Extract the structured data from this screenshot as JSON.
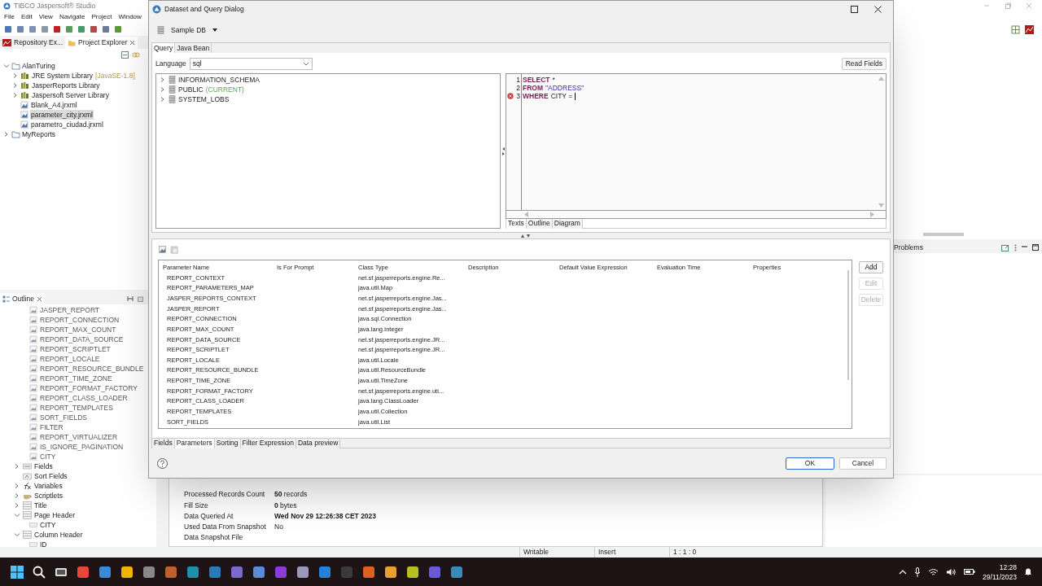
{
  "ide": {
    "title": "TIBCO Jaspersoft® Studio",
    "menu": [
      "File",
      "Edit",
      "View",
      "Navigate",
      "Project",
      "Window"
    ],
    "explorer_tabs": [
      {
        "label": "Repository Ex...",
        "selected": false
      },
      {
        "label": "Project Explorer",
        "selected": true
      }
    ],
    "explorer_tree": [
      {
        "label": "AlanTuring",
        "kind": "project",
        "expanded": true,
        "children": [
          {
            "label": "JRE System Library",
            "decoration": "[JavaSE-1.8]",
            "kind": "library",
            "expanded": false,
            "selected": false
          },
          {
            "label": "JasperReports Library",
            "kind": "library",
            "expanded": false,
            "selected": false
          },
          {
            "label": "Jaspersoft Server Library",
            "kind": "library",
            "expanded": false,
            "selected": false
          },
          {
            "label": "Blank_A4.jrxml",
            "kind": "file",
            "selected": false
          },
          {
            "label": "parameter_city.jrxml",
            "kind": "file",
            "selected": true
          },
          {
            "label": "parametro_ciudad.jrxml",
            "kind": "file",
            "selected": false
          }
        ]
      },
      {
        "label": "MyReports",
        "kind": "project",
        "expanded": false
      }
    ],
    "outline_tab": "Outline",
    "outline_parameters": [
      "JASPER_REPORT",
      "REPORT_CONNECTION",
      "REPORT_MAX_COUNT",
      "REPORT_DATA_SOURCE",
      "REPORT_SCRIPTLET",
      "REPORT_LOCALE",
      "REPORT_RESOURCE_BUNDLE",
      "REPORT_TIME_ZONE",
      "REPORT_FORMAT_FACTORY",
      "REPORT_CLASS_LOADER",
      "REPORT_TEMPLATES",
      "SORT_FIELDS",
      "FILTER",
      "REPORT_VIRTUALIZER",
      "IS_IGNORE_PAGINATION",
      "CITY"
    ],
    "outline_items": [
      {
        "label": "Fields",
        "kind": "fields",
        "expanded": false
      },
      {
        "label": "Sort Fields",
        "kind": "sort"
      },
      {
        "label": "Variables",
        "kind": "variables",
        "expanded": false
      },
      {
        "label": "Scriptlets",
        "kind": "scriptlets",
        "expanded": false
      },
      {
        "label": "Title",
        "kind": "band",
        "expanded": false
      },
      {
        "label": "Page Header",
        "kind": "band",
        "expanded": true,
        "children": [
          {
            "label": "CITY"
          }
        ]
      },
      {
        "label": "Column Header",
        "kind": "band",
        "expanded": true,
        "children": [
          {
            "label": "ID"
          }
        ]
      }
    ],
    "problems_tab": "Problems",
    "report_info": [
      {
        "label": "Processed Records Count",
        "value": "**50** records"
      },
      {
        "label": "Fill Size",
        "value": "**0** bytes"
      },
      {
        "label": "Data Queried At",
        "value": "**Wed Nov 29 12:26:38 CET 2023**"
      },
      {
        "label": "Used Data From Snapshot",
        "value": "No"
      },
      {
        "label": "Data Snapshot File"
      }
    ],
    "status_bar": [
      "Writable",
      "Insert",
      "1 : 1 : 0"
    ]
  },
  "dialog": {
    "title": "Dataset and Query Dialog",
    "data_adapter": "Sample DB",
    "top_tabs": [
      {
        "label": "Query",
        "selected": true
      },
      {
        "label": "Java Bean",
        "selected": false
      }
    ],
    "language_label": "Language",
    "language": "sql",
    "read_fields": "Read Fields",
    "schemas": [
      {
        "label": "INFORMATION_SCHEMA"
      },
      {
        "label": "PUBLIC",
        "note": "(CURRENT)"
      },
      {
        "label": "SYSTEM_LOBS"
      }
    ],
    "query_lines": [
      {
        "number": "1",
        "error": false,
        "tokens": [
          {
            "kind": "keyword",
            "text": "SELECT"
          },
          {
            "kind": "plain",
            "text": "*"
          }
        ]
      },
      {
        "number": "2",
        "error": false,
        "tokens": [
          {
            "kind": "keyword",
            "text": "FROM"
          },
          {
            "kind": "string",
            "text": "\"ADDRESS\""
          }
        ]
      },
      {
        "number": "3",
        "error": true,
        "tokens": [
          {
            "kind": "keyword",
            "text": "WHERE"
          },
          {
            "kind": "plain",
            "text": "CITY ="
          }
        ]
      }
    ],
    "editor_tabs": [
      {
        "label": "Texts",
        "selected": true
      },
      {
        "label": "Outline",
        "selected": false
      },
      {
        "label": "Diagram",
        "selected": false
      }
    ],
    "table": {
      "columns": [
        "Parameter Name",
        "Is For Prompt",
        "Class Type",
        "Description",
        "Default Value Expression",
        "Evaluation Time",
        "Properties"
      ],
      "rows": [
        {
          "name": "REPORT_CONTEXT",
          "class_type": "net.sf.jasperreports.engine.Re..."
        },
        {
          "name": "REPORT_PARAMETERS_MAP",
          "class_type": "java.util.Map"
        },
        {
          "name": "JASPER_REPORTS_CONTEXT",
          "class_type": "net.sf.jasperreports.engine.Jas..."
        },
        {
          "name": "JASPER_REPORT",
          "class_type": "net.sf.jasperreports.engine.Jas..."
        },
        {
          "name": "REPORT_CONNECTION",
          "class_type": "java.sql.Connection"
        },
        {
          "name": "REPORT_MAX_COUNT",
          "class_type": "java.lang.Integer"
        },
        {
          "name": "REPORT_DATA_SOURCE",
          "class_type": "net.sf.jasperreports.engine.JR..."
        },
        {
          "name": "REPORT_SCRIPTLET",
          "class_type": "net.sf.jasperreports.engine.JR..."
        },
        {
          "name": "REPORT_LOCALE",
          "class_type": "java.util.Locale"
        },
        {
          "name": "REPORT_RESOURCE_BUNDLE",
          "class_type": "java.util.ResourceBundle"
        },
        {
          "name": "REPORT_TIME_ZONE",
          "class_type": "java.util.TimeZone"
        },
        {
          "name": "REPORT_FORMAT_FACTORY",
          "class_type": "net.sf.jasperreports.engine.uti..."
        },
        {
          "name": "REPORT_CLASS_LOADER",
          "class_type": "java.lang.ClassLoader"
        },
        {
          "name": "REPORT_TEMPLATES",
          "class_type": "java.util.Collection"
        },
        {
          "name": "SORT_FIELDS",
          "class_type": "java.util.List"
        }
      ]
    },
    "side_buttons": [
      {
        "label": "Add",
        "disabled": false
      },
      {
        "label": "Edit",
        "disabled": true
      },
      {
        "label": "Delete",
        "disabled": true
      }
    ],
    "bottom_tabs": [
      {
        "label": "Fields",
        "selected": false
      },
      {
        "label": "Parameters",
        "selected": true
      },
      {
        "label": "Sorting",
        "selected": false
      },
      {
        "label": "Filter Expression",
        "selected": false
      },
      {
        "label": "Data preview",
        "selected": false
      }
    ],
    "ok": "OK",
    "cancel": "Cancel"
  },
  "taskbar": {
    "time": "12:28",
    "date": "29/11/2023"
  }
}
